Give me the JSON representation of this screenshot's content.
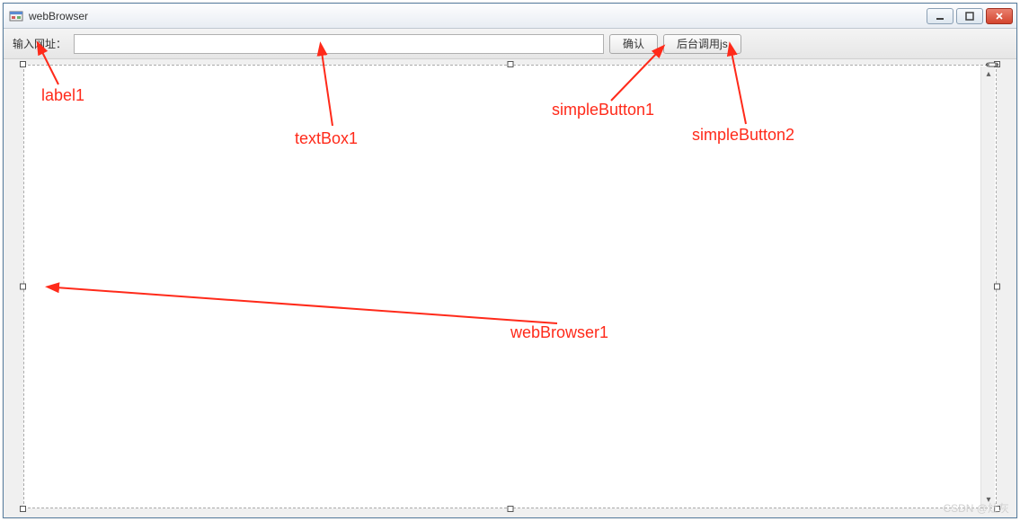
{
  "window": {
    "title": "webBrowser"
  },
  "toolbar": {
    "label": "输入网址：",
    "url_value": "",
    "confirm_label": "确认",
    "invoke_js_label": "后台调用js"
  },
  "annotations": {
    "label1": "label1",
    "textBox1": "textBox1",
    "simpleButton1": "simpleButton1",
    "simpleButton2": "simpleButton2",
    "webBrowser1": "webBrowser1"
  },
  "watermark": "CSDN @灶灰"
}
